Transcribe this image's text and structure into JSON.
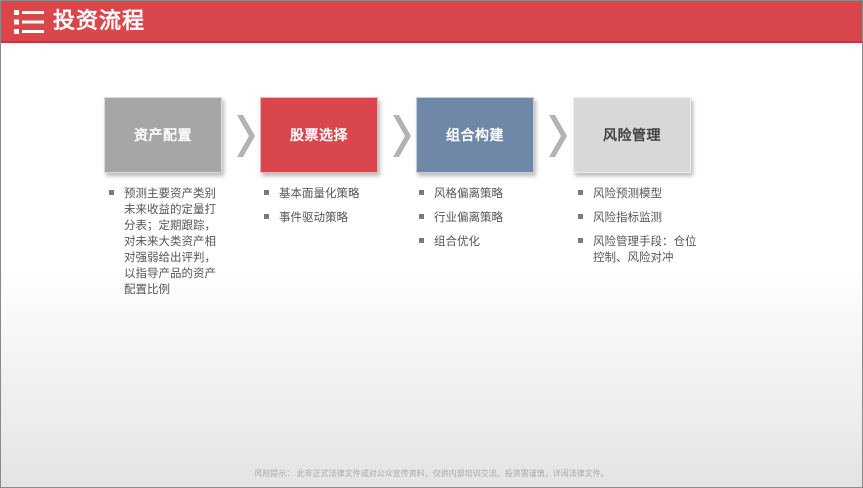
{
  "header": {
    "title": "投资流程",
    "icon": "list-icon",
    "bg_color": "#d9474d"
  },
  "steps": [
    {
      "label": "资产配置",
      "color": "#a6a6a6",
      "text_color": "#ffffff",
      "items": [
        "预测主要资产类别未来收益的定量打分表；定期跟踪，对未来大类资产相对强弱给出评判，以指导产品的资产配置比例"
      ]
    },
    {
      "label": "股票选择",
      "color": "#d9474d",
      "text_color": "#ffffff",
      "items": [
        "基本面量化策略",
        "事件驱动策略"
      ]
    },
    {
      "label": "组合构建",
      "color": "#6f88a8",
      "text_color": "#ffffff",
      "items": [
        "风格偏离策略",
        "行业偏离策略",
        "组合优化"
      ]
    },
    {
      "label": "风险管理",
      "color": "#d8d8d8",
      "text_color": "#404040",
      "items": [
        "风险预测模型",
        "风险指标监测",
        "风险管理手段：仓位控制、风险对冲"
      ]
    }
  ],
  "arrow_icon": "chevron-right-icon",
  "arrow_color": "#b3b3b3",
  "footer": {
    "text": "风险提示：  此非正式法律文件或对公众宣传资料，仅供内部培训交流。投资需谨慎，详阅法律文件。"
  }
}
